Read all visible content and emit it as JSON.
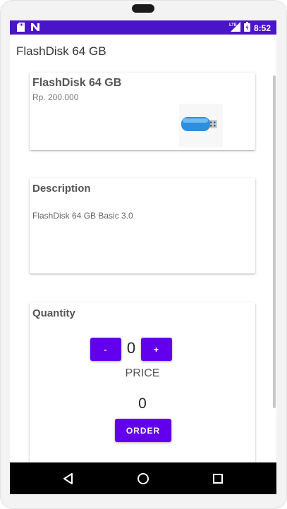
{
  "status_bar": {
    "time": "8:52",
    "network": "LTE",
    "background_color": "#4a14c8",
    "left_icons": [
      "sd-card-icon",
      "nfc-icon"
    ],
    "right_icons": [
      "signal-icon",
      "battery-icon"
    ]
  },
  "app_bar": {
    "title": "FlashDisk 64 GB"
  },
  "product_card": {
    "name": "FlashDisk 64 GB",
    "price": "Rp. 200.000",
    "image_icon": "usb-flash-drive-icon"
  },
  "description_card": {
    "title": "Description",
    "text": "FlashDisk 64 GB Basic 3.0"
  },
  "quantity_card": {
    "title": "Quantity",
    "minus_label": "-",
    "plus_label": "+",
    "quantity": "0",
    "price_label": "PRICE",
    "price_value": "0",
    "order_label": "ORDER",
    "button_color": "#6200ee"
  },
  "nav_bar": {
    "icons": [
      "back-icon",
      "home-icon",
      "recents-icon"
    ]
  }
}
